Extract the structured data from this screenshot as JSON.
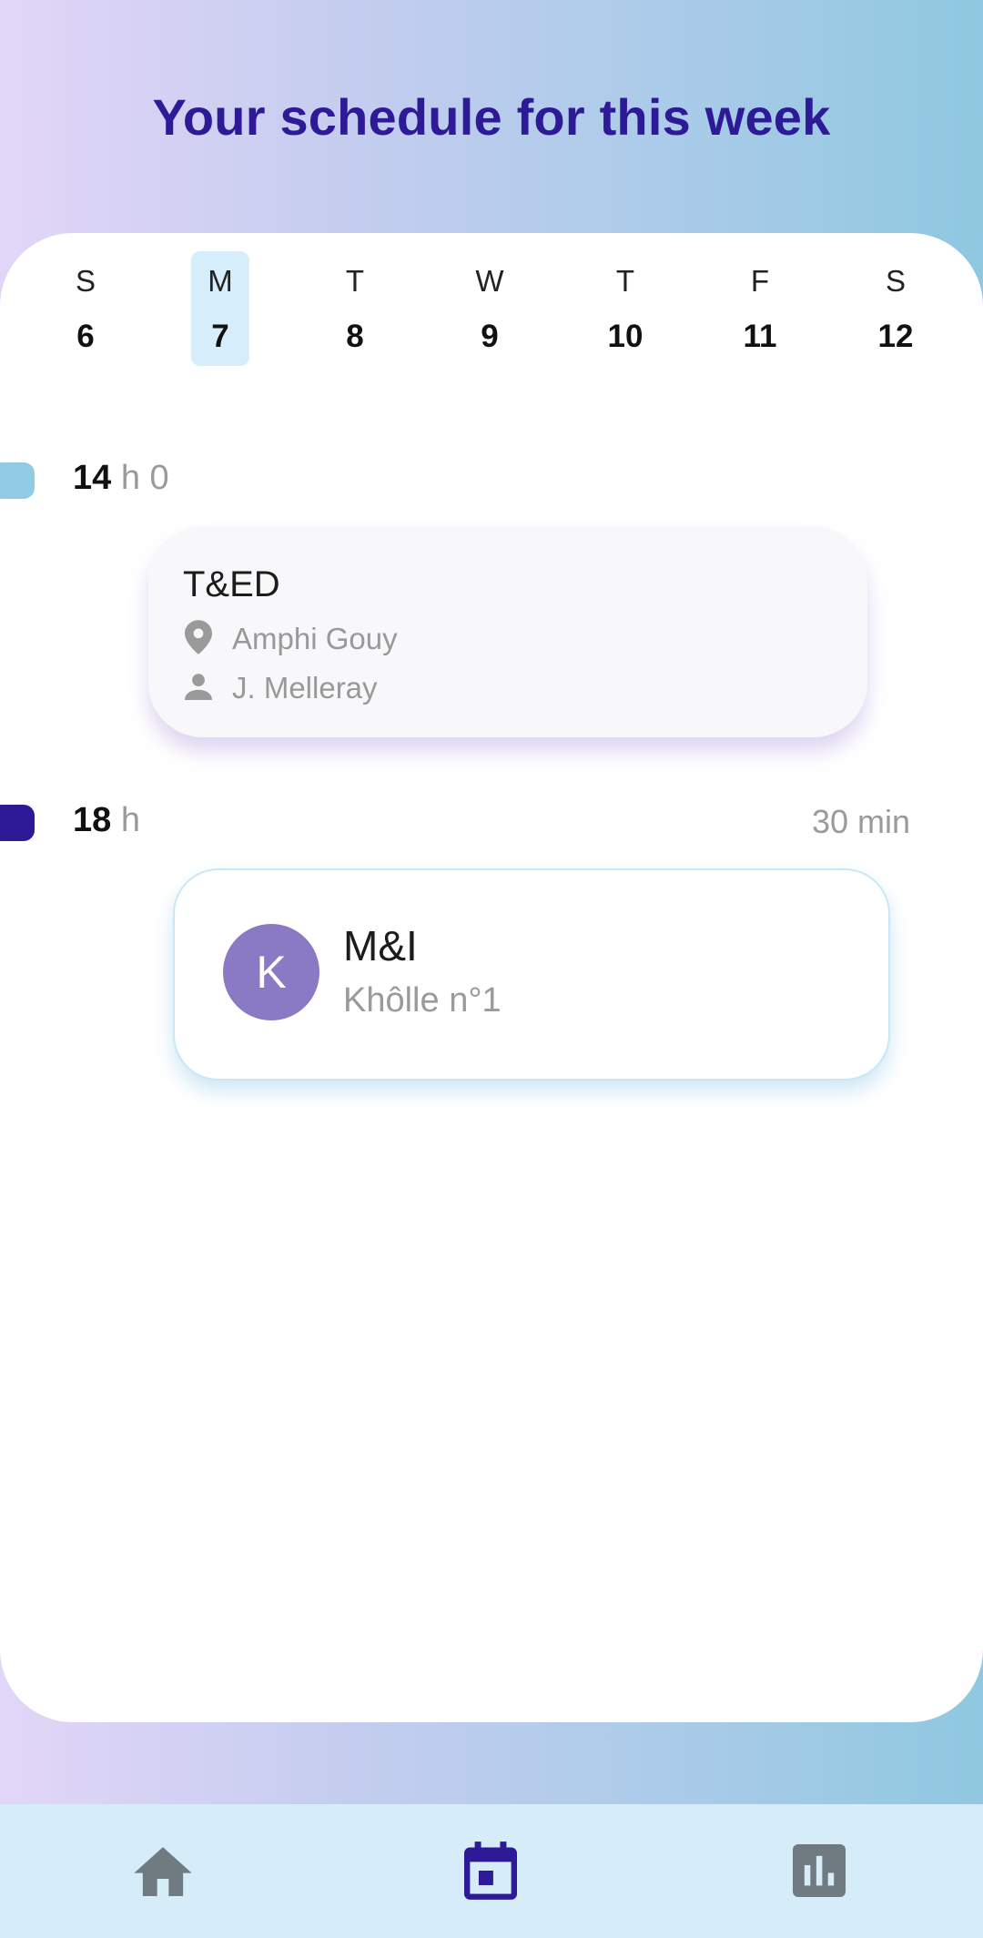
{
  "header": {
    "title": "Your schedule for this week"
  },
  "week": {
    "days": [
      {
        "letter": "S",
        "number": "6"
      },
      {
        "letter": "M",
        "number": "7"
      },
      {
        "letter": "T",
        "number": "8"
      },
      {
        "letter": "W",
        "number": "9"
      },
      {
        "letter": "T",
        "number": "10"
      },
      {
        "letter": "F",
        "number": "11"
      },
      {
        "letter": "S",
        "number": "12"
      }
    ],
    "selected_day": "7"
  },
  "schedule": [
    {
      "time_hour": "14",
      "time_rest": "h 0",
      "marker_color": "#8fcbe3",
      "event": {
        "title": "T&ED",
        "location": "Amphi Gouy",
        "teacher": "J. Melleray"
      }
    },
    {
      "time_hour": "18",
      "time_rest": "h",
      "duration": "30 min",
      "marker_color": "#2e1a96",
      "event": {
        "avatar_letter": "K",
        "title": "M&I",
        "subtitle": "Khôlle n°1"
      }
    }
  ],
  "nav": {
    "items": [
      {
        "icon": "home-icon",
        "active": false
      },
      {
        "icon": "calendar-icon",
        "active": true
      },
      {
        "icon": "bar-chart-icon",
        "active": false
      }
    ]
  },
  "colors": {
    "accent": "#2e1a96",
    "selected_day_bg": "#d6eefb",
    "nav_bg": "#d6ecf9",
    "avatar": "#8a79c3"
  }
}
